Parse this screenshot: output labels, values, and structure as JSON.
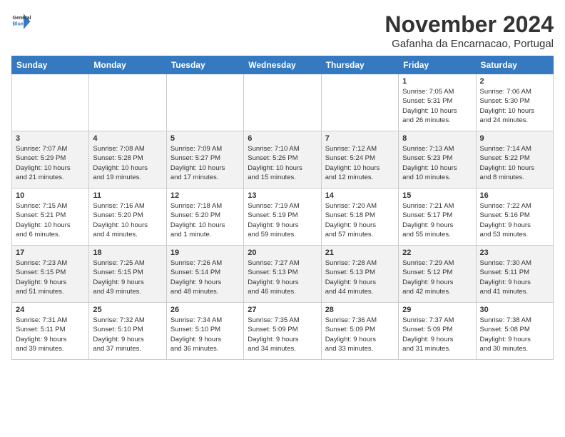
{
  "header": {
    "logo_line1": "General",
    "logo_line2": "Blue",
    "month_year": "November 2024",
    "location": "Gafanha da Encarnacao, Portugal"
  },
  "weekdays": [
    "Sunday",
    "Monday",
    "Tuesday",
    "Wednesday",
    "Thursday",
    "Friday",
    "Saturday"
  ],
  "weeks": [
    [
      {
        "day": "",
        "info": ""
      },
      {
        "day": "",
        "info": ""
      },
      {
        "day": "",
        "info": ""
      },
      {
        "day": "",
        "info": ""
      },
      {
        "day": "",
        "info": ""
      },
      {
        "day": "1",
        "info": "Sunrise: 7:05 AM\nSunset: 5:31 PM\nDaylight: 10 hours\nand 26 minutes."
      },
      {
        "day": "2",
        "info": "Sunrise: 7:06 AM\nSunset: 5:30 PM\nDaylight: 10 hours\nand 24 minutes."
      }
    ],
    [
      {
        "day": "3",
        "info": "Sunrise: 7:07 AM\nSunset: 5:29 PM\nDaylight: 10 hours\nand 21 minutes."
      },
      {
        "day": "4",
        "info": "Sunrise: 7:08 AM\nSunset: 5:28 PM\nDaylight: 10 hours\nand 19 minutes."
      },
      {
        "day": "5",
        "info": "Sunrise: 7:09 AM\nSunset: 5:27 PM\nDaylight: 10 hours\nand 17 minutes."
      },
      {
        "day": "6",
        "info": "Sunrise: 7:10 AM\nSunset: 5:26 PM\nDaylight: 10 hours\nand 15 minutes."
      },
      {
        "day": "7",
        "info": "Sunrise: 7:12 AM\nSunset: 5:24 PM\nDaylight: 10 hours\nand 12 minutes."
      },
      {
        "day": "8",
        "info": "Sunrise: 7:13 AM\nSunset: 5:23 PM\nDaylight: 10 hours\nand 10 minutes."
      },
      {
        "day": "9",
        "info": "Sunrise: 7:14 AM\nSunset: 5:22 PM\nDaylight: 10 hours\nand 8 minutes."
      }
    ],
    [
      {
        "day": "10",
        "info": "Sunrise: 7:15 AM\nSunset: 5:21 PM\nDaylight: 10 hours\nand 6 minutes."
      },
      {
        "day": "11",
        "info": "Sunrise: 7:16 AM\nSunset: 5:20 PM\nDaylight: 10 hours\nand 4 minutes."
      },
      {
        "day": "12",
        "info": "Sunrise: 7:18 AM\nSunset: 5:20 PM\nDaylight: 10 hours\nand 1 minute."
      },
      {
        "day": "13",
        "info": "Sunrise: 7:19 AM\nSunset: 5:19 PM\nDaylight: 9 hours\nand 59 minutes."
      },
      {
        "day": "14",
        "info": "Sunrise: 7:20 AM\nSunset: 5:18 PM\nDaylight: 9 hours\nand 57 minutes."
      },
      {
        "day": "15",
        "info": "Sunrise: 7:21 AM\nSunset: 5:17 PM\nDaylight: 9 hours\nand 55 minutes."
      },
      {
        "day": "16",
        "info": "Sunrise: 7:22 AM\nSunset: 5:16 PM\nDaylight: 9 hours\nand 53 minutes."
      }
    ],
    [
      {
        "day": "17",
        "info": "Sunrise: 7:23 AM\nSunset: 5:15 PM\nDaylight: 9 hours\nand 51 minutes."
      },
      {
        "day": "18",
        "info": "Sunrise: 7:25 AM\nSunset: 5:15 PM\nDaylight: 9 hours\nand 49 minutes."
      },
      {
        "day": "19",
        "info": "Sunrise: 7:26 AM\nSunset: 5:14 PM\nDaylight: 9 hours\nand 48 minutes."
      },
      {
        "day": "20",
        "info": "Sunrise: 7:27 AM\nSunset: 5:13 PM\nDaylight: 9 hours\nand 46 minutes."
      },
      {
        "day": "21",
        "info": "Sunrise: 7:28 AM\nSunset: 5:13 PM\nDaylight: 9 hours\nand 44 minutes."
      },
      {
        "day": "22",
        "info": "Sunrise: 7:29 AM\nSunset: 5:12 PM\nDaylight: 9 hours\nand 42 minutes."
      },
      {
        "day": "23",
        "info": "Sunrise: 7:30 AM\nSunset: 5:11 PM\nDaylight: 9 hours\nand 41 minutes."
      }
    ],
    [
      {
        "day": "24",
        "info": "Sunrise: 7:31 AM\nSunset: 5:11 PM\nDaylight: 9 hours\nand 39 minutes."
      },
      {
        "day": "25",
        "info": "Sunrise: 7:32 AM\nSunset: 5:10 PM\nDaylight: 9 hours\nand 37 minutes."
      },
      {
        "day": "26",
        "info": "Sunrise: 7:34 AM\nSunset: 5:10 PM\nDaylight: 9 hours\nand 36 minutes."
      },
      {
        "day": "27",
        "info": "Sunrise: 7:35 AM\nSunset: 5:09 PM\nDaylight: 9 hours\nand 34 minutes."
      },
      {
        "day": "28",
        "info": "Sunrise: 7:36 AM\nSunset: 5:09 PM\nDaylight: 9 hours\nand 33 minutes."
      },
      {
        "day": "29",
        "info": "Sunrise: 7:37 AM\nSunset: 5:09 PM\nDaylight: 9 hours\nand 31 minutes."
      },
      {
        "day": "30",
        "info": "Sunrise: 7:38 AM\nSunset: 5:08 PM\nDaylight: 9 hours\nand 30 minutes."
      }
    ]
  ]
}
